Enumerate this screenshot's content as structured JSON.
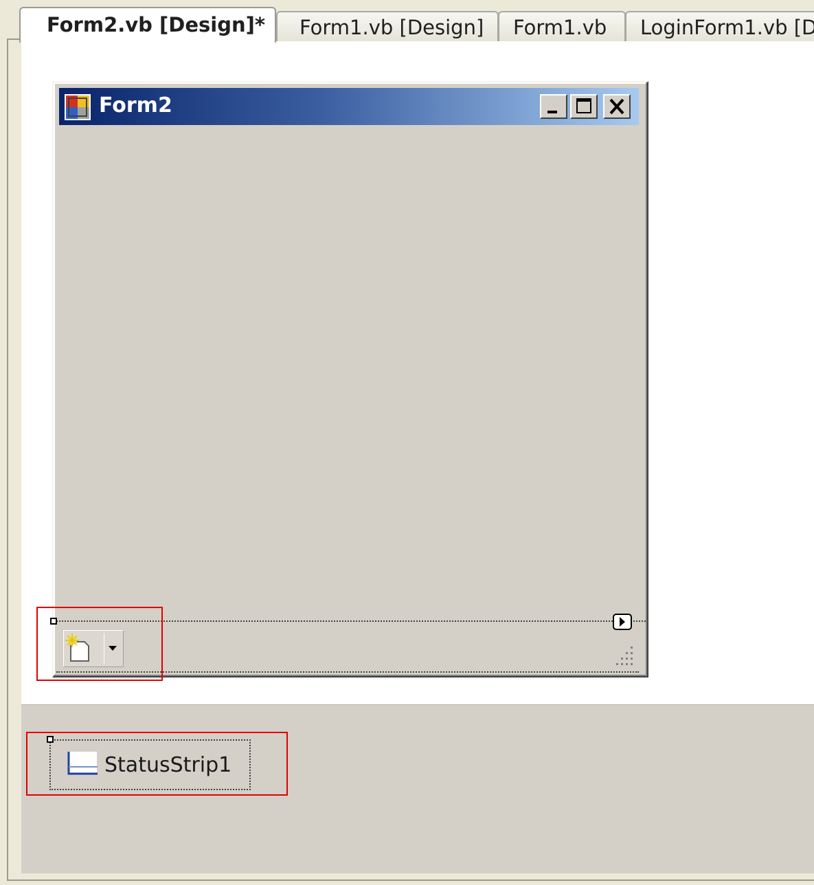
{
  "tabs": [
    {
      "label": "Form2.vb [Design]*",
      "active": true
    },
    {
      "label": "Form1.vb [Design]",
      "active": false
    },
    {
      "label": "Form1.vb",
      "active": false
    },
    {
      "label": "LoginForm1.vb [D",
      "active": false
    }
  ],
  "form": {
    "title": "Form2",
    "buttons": {
      "minimize": "minimize",
      "maximize": "maximize",
      "close": "close"
    }
  },
  "status_strip": {
    "split_button_icon": "new-item-icon",
    "dropdown_icon": "dropdown-arrow-icon",
    "smart_tag_icon": "smart-tag-arrow-icon",
    "grip_icon": "resize-grip-icon"
  },
  "component_tray": {
    "items": [
      {
        "label": "StatusStrip1",
        "icon": "statusstrip-icon"
      }
    ]
  },
  "colors": {
    "title_bar_start": "#0a246a",
    "title_bar_end": "#a6caf0",
    "form_face": "#d4d0c8",
    "highlight": "#e00000"
  }
}
